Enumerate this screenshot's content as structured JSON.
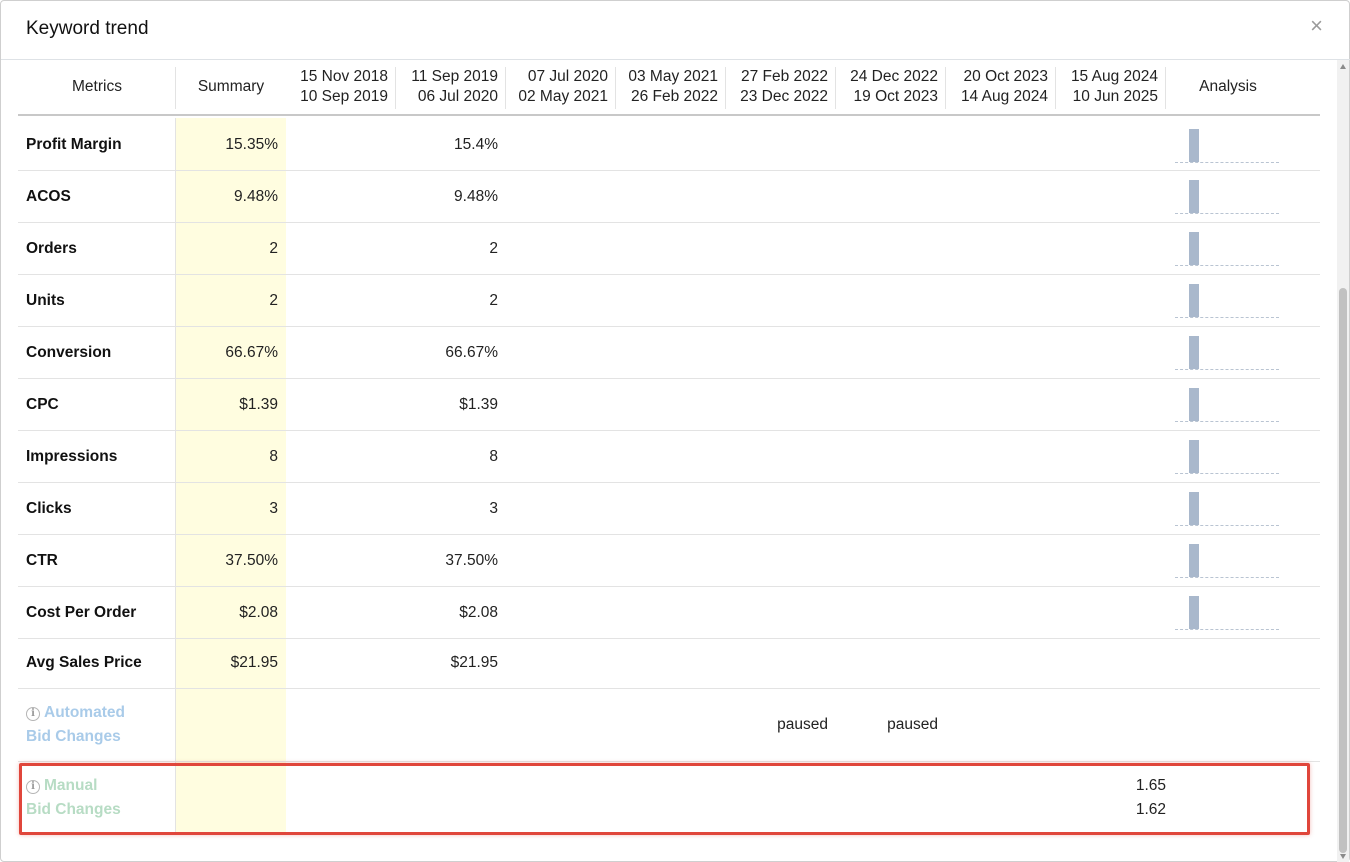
{
  "modal": {
    "title": "Keyword trend",
    "close": "×"
  },
  "header": {
    "metrics": "Metrics",
    "summary": "Summary",
    "analysis": "Analysis",
    "periods": [
      {
        "start": "15 Nov 2018",
        "end": "10 Sep 2019"
      },
      {
        "start": "11 Sep 2019",
        "end": "06 Jul 2020"
      },
      {
        "start": "07 Jul 2020",
        "end": "02 May 2021"
      },
      {
        "start": "03 May 2021",
        "end": "26 Feb 2022"
      },
      {
        "start": "27 Feb 2022",
        "end": "23 Dec 2022"
      },
      {
        "start": "24 Dec 2022",
        "end": "19 Oct 2023"
      },
      {
        "start": "20 Oct 2023",
        "end": "14 Aug 2024"
      },
      {
        "start": "15 Aug 2024",
        "end": "10 Jun 2025"
      }
    ]
  },
  "rows": [
    {
      "label": "Profit Margin",
      "summary": "15.35%",
      "first": "15.4%",
      "spark": true
    },
    {
      "label": "ACOS",
      "summary": "9.48%",
      "first": "9.48%",
      "spark": true
    },
    {
      "label": "Orders",
      "summary": "2",
      "first": "2",
      "spark": true
    },
    {
      "label": "Units",
      "summary": "2",
      "first": "2",
      "spark": true
    },
    {
      "label": "Conversion",
      "summary": "66.67%",
      "first": "66.67%",
      "spark": true
    },
    {
      "label": "CPC",
      "summary": "$1.39",
      "first": "$1.39",
      "spark": true
    },
    {
      "label": "Impressions",
      "summary": "8",
      "first": "8",
      "spark": true
    },
    {
      "label": "Clicks",
      "summary": "3",
      "first": "3",
      "spark": true
    },
    {
      "label": "CTR",
      "summary": "37.50%",
      "first": "37.50%",
      "spark": true
    },
    {
      "label": "Cost Per Order",
      "summary": "$2.08",
      "first": "$2.08",
      "spark": true
    },
    {
      "label": "Avg Sales Price",
      "summary": "$21.95",
      "first": "$21.95",
      "spark": false
    }
  ],
  "automated": {
    "line1": "Automated",
    "line2": "Bid Changes",
    "values": [
      "paused",
      "paused"
    ]
  },
  "manual": {
    "line1": "Manual",
    "line2": "Bid Changes",
    "values": [
      "1.65",
      "1.62"
    ]
  },
  "info_icon": "i"
}
